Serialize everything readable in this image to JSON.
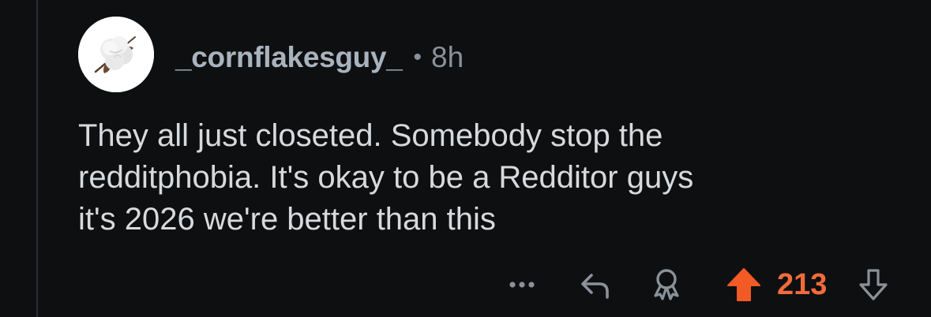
{
  "comment": {
    "username": "_cornflakesguy_",
    "separator": "•",
    "time_ago": "8h",
    "body": "They all just closeted. Somebody stop the\nredditphobia. It's okay to be a Redditor guys\nit's 2026 we're better than this"
  },
  "actions": {
    "more_icon": "ellipsis-icon",
    "reply_icon": "reply-arrow-icon",
    "award_icon": "award-icon",
    "upvote_icon": "upvote-arrow-icon",
    "score": "213",
    "downvote_icon": "downvote-arrow-icon"
  },
  "colors": {
    "background": "#0e0f11",
    "text": "#d7dadc",
    "username": "#a9b3bd",
    "muted": "#8a9199",
    "upvote": "#f26b3a"
  }
}
